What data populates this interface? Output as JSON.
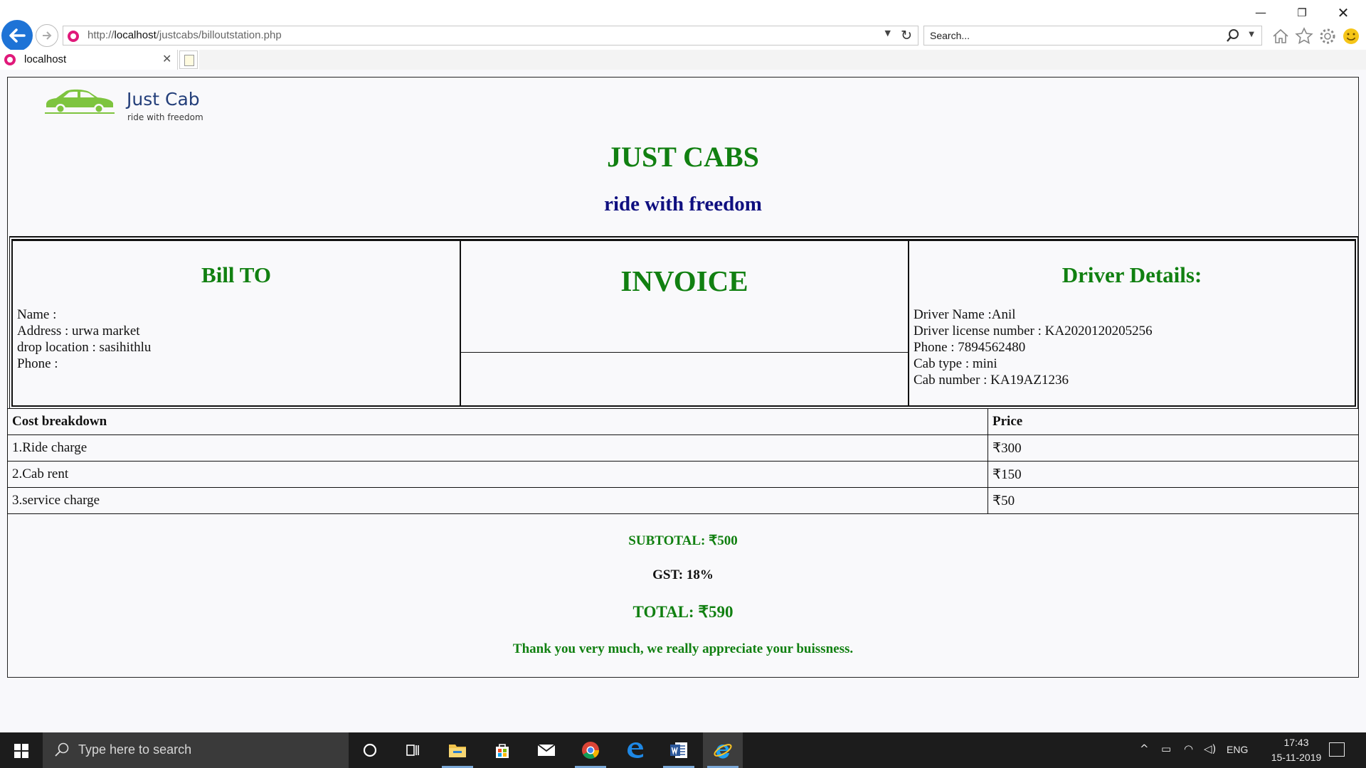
{
  "browser": {
    "url_prefix": "http://",
    "url_host": "localhost",
    "url_path": "/justcabs/billoutstation.php",
    "search_placeholder": "Search...",
    "tab_title": "localhost",
    "window_controls": {
      "minimize": "—",
      "maximize": "❐",
      "close": "✕"
    }
  },
  "logo": {
    "name": "Just Cab",
    "tagline": "ride with freedom",
    "car_color": "#7ec43f",
    "icon": "car-logo-icon"
  },
  "header": {
    "title": "JUST CABS",
    "subtitle": "ride with freedom"
  },
  "bill_to": {
    "heading": "Bill TO",
    "lines": [
      "Name :",
      "Address : urwa market",
      "drop location : sasihithlu",
      "Phone :"
    ]
  },
  "invoice": {
    "heading": "INVOICE"
  },
  "driver": {
    "heading": "Driver Details:",
    "lines": [
      "Driver Name :Anil",
      "Driver license number : KA2020120205256",
      "Phone : 7894562480",
      "Cab type : mini",
      "Cab number : KA19AZ1236"
    ]
  },
  "cost_table": {
    "headers": [
      "Cost breakdown",
      "Price"
    ],
    "rows": [
      [
        "1.Ride charge",
        "₹300"
      ],
      [
        "2.Cab rent",
        "₹150"
      ],
      [
        "3.service charge",
        "₹50"
      ]
    ]
  },
  "summary": {
    "subtotal": "SUBTOTAL: ₹500",
    "gst": "GST: 18%",
    "total": "TOTAL: ₹590",
    "thanks": "Thank you very much, we really appreciate your buissness."
  },
  "colors": {
    "green": "#118011",
    "navy": "#101080",
    "browser_blue": "#1e73d6",
    "taskbar": "#1c1c1c"
  },
  "taskbar": {
    "search_placeholder": "Type here to search",
    "apps": [
      "cortana-icon",
      "task-view-icon",
      "file-explorer-icon",
      "store-icon",
      "mail-icon",
      "chrome-icon",
      "edge-icon",
      "word-icon",
      "internet-explorer-icon"
    ],
    "language": "ENG",
    "time": "17:43",
    "date": "15-11-2019"
  }
}
